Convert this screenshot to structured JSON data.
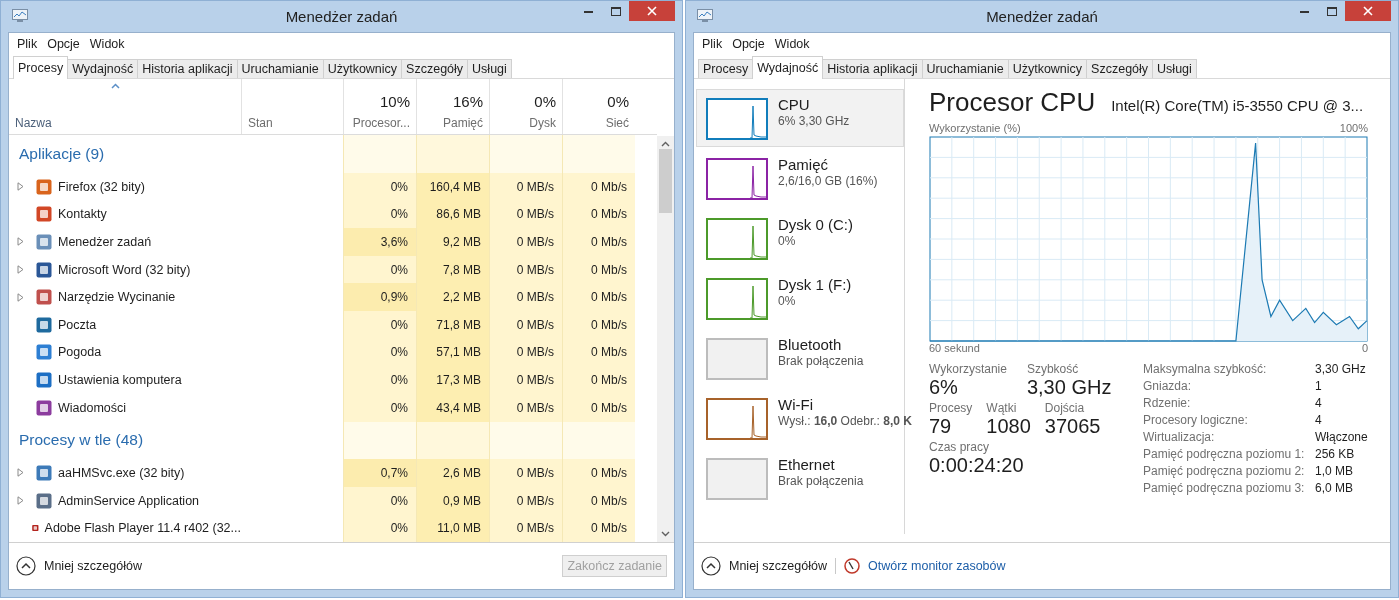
{
  "windows": [
    {
      "kind": "processes",
      "title": "Menedżer zadań",
      "menu": [
        "Plik",
        "Opcje",
        "Widok"
      ],
      "tabs": [
        {
          "label": "Procesy",
          "selected": true
        },
        {
          "label": "Wydajność",
          "selected": false
        },
        {
          "label": "Historia aplikacji",
          "selected": false
        },
        {
          "label": "Uruchamianie",
          "selected": false
        },
        {
          "label": "Użytkownicy",
          "selected": false
        },
        {
          "label": "Szczegóły",
          "selected": false
        },
        {
          "label": "Usługi",
          "selected": false
        }
      ],
      "columns": [
        {
          "label": "Nazwa",
          "sorted": true
        },
        {
          "label": "Stan",
          "sorted": false
        },
        {
          "total": "10%",
          "label": "Procesor...",
          "sorted": false
        },
        {
          "total": "16%",
          "label": "Pamięć",
          "sorted": false
        },
        {
          "total": "0%",
          "label": "Dysk",
          "sorted": false
        },
        {
          "total": "0%",
          "label": "Sieć",
          "sorted": false
        }
      ],
      "groups": [
        {
          "title": "Aplikacje (9)",
          "rows": [
            {
              "name": "Firefox (32 bity)",
              "expandable": true,
              "cpu_busy": false,
              "color": "#d9641c",
              "cells": [
                "0%",
                "160,4 MB",
                "0 MB/s",
                "0 Mb/s"
              ]
            },
            {
              "name": "Kontakty",
              "expandable": false,
              "cpu_busy": false,
              "color": "#d24726",
              "cells": [
                "0%",
                "86,6 MB",
                "0 MB/s",
                "0 Mb/s"
              ]
            },
            {
              "name": "Menedżer zadań",
              "expandable": true,
              "cpu_busy": true,
              "color": "#6a8fb8",
              "cells": [
                "3,6%",
                "9,2 MB",
                "0 MB/s",
                "0 Mb/s"
              ]
            },
            {
              "name": "Microsoft Word (32 bity)",
              "expandable": true,
              "cpu_busy": false,
              "color": "#2b5797",
              "cells": [
                "0%",
                "7,8 MB",
                "0 MB/s",
                "0 Mb/s"
              ]
            },
            {
              "name": "Narzędzie Wycinanie",
              "expandable": true,
              "cpu_busy": true,
              "color": "#c0504d",
              "cells": [
                "0,9%",
                "2,2 MB",
                "0 MB/s",
                "0 Mb/s"
              ]
            },
            {
              "name": "Poczta",
              "expandable": false,
              "cpu_busy": false,
              "color": "#1e6a9e",
              "cells": [
                "0%",
                "71,8 MB",
                "0 MB/s",
                "0 Mb/s"
              ]
            },
            {
              "name": "Pogoda",
              "expandable": false,
              "cpu_busy": false,
              "color": "#2d7fd3",
              "cells": [
                "0%",
                "57,1 MB",
                "0 MB/s",
                "0 Mb/s"
              ]
            },
            {
              "name": "Ustawienia komputera",
              "expandable": false,
              "cpu_busy": false,
              "color": "#1d6fc4",
              "cells": [
                "0%",
                "17,3 MB",
                "0 MB/s",
                "0 Mb/s"
              ]
            },
            {
              "name": "Wiadomości",
              "expandable": false,
              "cpu_busy": false,
              "color": "#8c3c9e",
              "cells": [
                "0%",
                "43,4 MB",
                "0 MB/s",
                "0 Mb/s"
              ]
            }
          ]
        },
        {
          "title": "Procesy w tle (48)",
          "rows": [
            {
              "name": "aaHMSvc.exe (32 bity)",
              "expandable": true,
              "cpu_busy": true,
              "color": "#3d7ab8",
              "cells": [
                "0,7%",
                "2,6 MB",
                "0 MB/s",
                "0 Mb/s"
              ]
            },
            {
              "name": "AdminService Application",
              "expandable": true,
              "cpu_busy": false,
              "color": "#5a6e88",
              "cells": [
                "0%",
                "0,9 MB",
                "0 MB/s",
                "0 Mb/s"
              ]
            },
            {
              "name": "Adobe Flash Player 11.4 r402 (32...",
              "expandable": false,
              "cpu_busy": false,
              "color": "#b3241e",
              "cells": [
                "0%",
                "11,0 MB",
                "0 MB/s",
                "0 Mb/s"
              ]
            }
          ]
        }
      ],
      "footer": {
        "details": "Mniej szczegółów",
        "end_task": {
          "label": "Zakończ zadanie",
          "disabled": true
        }
      }
    },
    {
      "kind": "performance",
      "title": "Menedżer zadań",
      "menu": [
        "Plik",
        "Opcje",
        "Widok"
      ],
      "tabs": [
        {
          "label": "Procesy",
          "selected": false
        },
        {
          "label": "Wydajność",
          "selected": true
        },
        {
          "label": "Historia aplikacji",
          "selected": false
        },
        {
          "label": "Uruchamianie",
          "selected": false
        },
        {
          "label": "Użytkownicy",
          "selected": false
        },
        {
          "label": "Szczegóły",
          "selected": false
        },
        {
          "label": "Usługi",
          "selected": false
        }
      ],
      "resources": [
        {
          "name": "CPU",
          "detail": "6% 3,30 GHz",
          "color": "#117dbb",
          "connected": true,
          "selected": true
        },
        {
          "name": "Pamięć",
          "detail": "2,6/16,0 GB (16%)",
          "color": "#8b23a5",
          "connected": true,
          "selected": false
        },
        {
          "name": "Dysk 0 (C:)",
          "detail": "0%",
          "color": "#4c9a2a",
          "connected": true,
          "selected": false
        },
        {
          "name": "Dysk 1 (F:)",
          "detail": "0%",
          "color": "#4c9a2a",
          "connected": true,
          "selected": false
        },
        {
          "name": "Bluetooth",
          "detail": "Brak połączenia",
          "color": "#bcbcbc",
          "connected": false,
          "selected": false
        },
        {
          "name": "Wi-Fi",
          "detail": "Wysł.: **16,0** Odebr.: **8,0 K**",
          "color": "#a7622a",
          "connected": true,
          "selected": false
        },
        {
          "name": "Ethernet",
          "detail": "Brak połączenia",
          "color": "#bcbcbc",
          "connected": false,
          "selected": false
        }
      ],
      "detail": {
        "title": "Procesor CPU",
        "model": "Intel(R) Core(TM) i5-3550 CPU @ 3...",
        "chart_label": "Wykorzystanie (%)",
        "chart_max": "100%",
        "chart_span": "60 sekund",
        "chart_end": "0",
        "stat_rows": [
          [
            {
              "label": "Wykorzystanie",
              "value": "6%"
            },
            {
              "label": "Szybkość",
              "value": "3,30 GHz"
            }
          ],
          [
            {
              "label": "Procesy",
              "value": "79"
            },
            {
              "label": "Wątki",
              "value": "1080"
            },
            {
              "label": "Dojścia",
              "value": "37065"
            }
          ],
          [
            {
              "label": "Czas pracy",
              "value": "0:00:24:20"
            }
          ]
        ],
        "specs": [
          {
            "label": "Maksymalna szybkość:",
            "value": "3,30 GHz"
          },
          {
            "label": "Gniazda:",
            "value": "1"
          },
          {
            "label": "Rdzenie:",
            "value": "4"
          },
          {
            "label": "Procesory logiczne:",
            "value": "4"
          },
          {
            "label": "Wirtualizacja:",
            "value": "Włączone"
          },
          {
            "label": "Pamięć podręczna poziomu 1:",
            "value": "256 KB"
          },
          {
            "label": "Pamięć podręczna poziomu 2:",
            "value": "1,0 MB"
          },
          {
            "label": "Pamięć podręczna poziomu 3:",
            "value": "6,0 MB"
          }
        ]
      },
      "footer": {
        "details": "Mniej szczegółów",
        "monitor_link": "Otwórz monitor zasobów"
      }
    }
  ]
}
